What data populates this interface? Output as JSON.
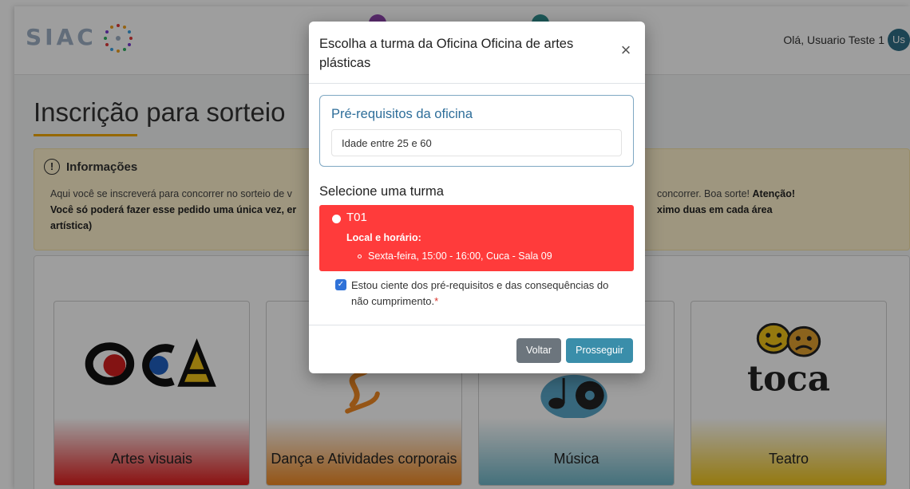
{
  "navbar": {
    "logo_text": "SIAC",
    "greeting": "Olá, Usuario Teste 1",
    "avatar_initials": "Us"
  },
  "page": {
    "title": "Inscrição para sorteio"
  },
  "info": {
    "heading": "Informações",
    "text_part1": "Aqui você se inscreverá para concorrer no sorteio de v",
    "text_bold_line": "Você só poderá fazer esse pedido uma única vez, er",
    "text_bold_tail": "artística)",
    "right_line1": "concorrer. Boa sorte!",
    "right_line1_bold": "Atenção!",
    "right_line2_bold": "ximo duas em cada área"
  },
  "cards": [
    {
      "label": "Artes visuais",
      "logo": "OCA",
      "color": "#e11d1d"
    },
    {
      "label": "Dança e Atividades corporais",
      "color": "#f08a24"
    },
    {
      "label": "Música",
      "color": "#6fb6c8"
    },
    {
      "label": "Teatro",
      "logo": "toca",
      "color": "#f0c419"
    }
  ],
  "modal": {
    "title": "Escolha a turma da Oficina Oficina de artes plásticas",
    "close_icon": "close-icon",
    "prereq_title": "Pré-requisitos da oficina",
    "prereq_value": "Idade entre 25 e 60",
    "select_label": "Selecione uma turma",
    "turma": {
      "name": "T01",
      "location_label": "Local e horário:",
      "schedule": "Sexta-feira, 15:00 - 16:00, Cuca - Sala 09",
      "color": "#ff3b3b"
    },
    "ack_text": "Estou ciente dos pré-requisitos e das consequências do não cumprimento.",
    "ack_required": "*",
    "ack_checked": true,
    "buttons": {
      "back": "Voltar",
      "proceed": "Prosseguir"
    }
  }
}
